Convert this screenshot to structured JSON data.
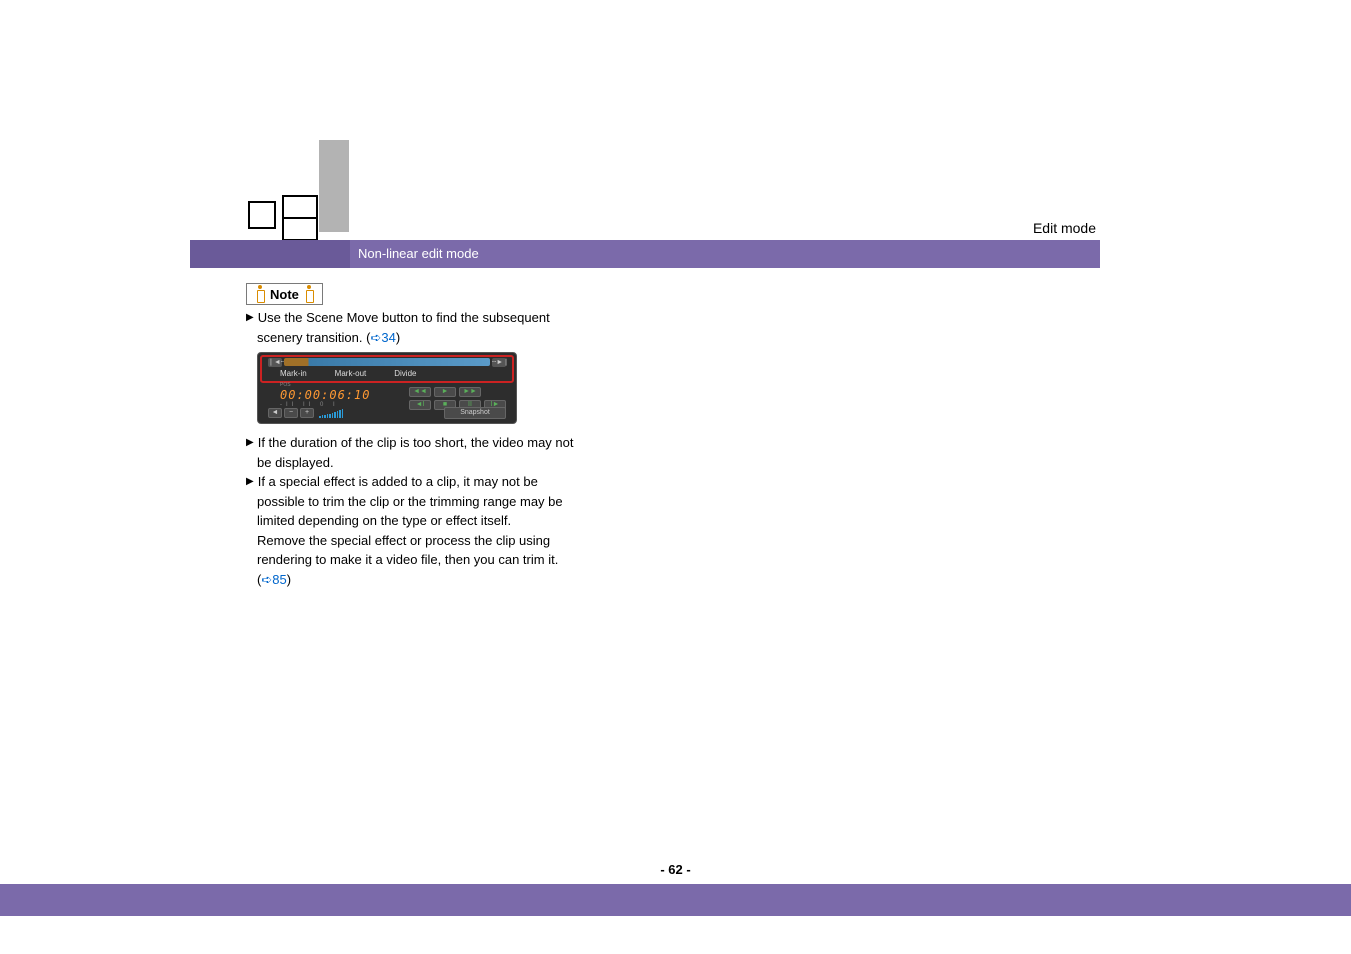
{
  "breadcrumb": "Edit mode",
  "section_title": "Non-linear edit mode",
  "note_label": "Note",
  "bullet1": {
    "line1": "Use the Scene Move button to find the subsequent",
    "line2_prefix": "scenery transition. (",
    "link": "34",
    "line2_suffix": ")"
  },
  "screenshot": {
    "arrow_left": "❘◄┄",
    "arrow_right": "┄►❘",
    "buttons": [
      "Mark-in",
      "Mark-out",
      "Divide"
    ],
    "tc_label": "POS",
    "timecode": "00:00:06:10",
    "marks": "-II   II   0   I",
    "transport_row1": [
      "◄◄",
      "►",
      "►►"
    ],
    "transport_row2": [
      "◄I",
      "■",
      "II",
      "I►"
    ],
    "vol_icon": "◄",
    "vol_minus": "−",
    "vol_plus": "+",
    "snapshot": "Snapshot"
  },
  "bullet2": {
    "line1": "If the duration of the clip is too short, the video may not",
    "line2": "be displayed."
  },
  "bullet3": {
    "line1": "If a special effect is added to a clip, it may not be",
    "line2": "possible to trim the clip or the trimming range may be",
    "line3": "limited depending on the type or effect itself.",
    "line4": "Remove the special effect or process the clip using",
    "line5": "rendering to make it a video file, then you can trim it.",
    "line6_prefix": "(",
    "link": "85",
    "line6_suffix": ")"
  },
  "page_number": "- 62 -",
  "link_arrow": "➪"
}
